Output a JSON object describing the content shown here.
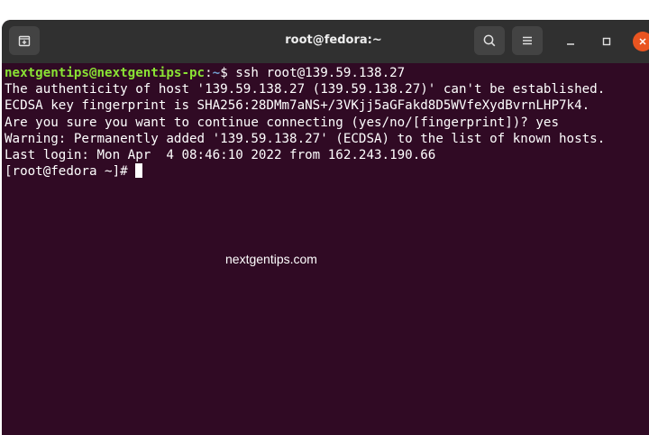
{
  "window": {
    "title": "root@fedora:~"
  },
  "colors": {
    "terminal_bg": "#300a24",
    "prompt_user": "#8ae234",
    "prompt_path": "#729fcf",
    "close_button": "#e95420"
  },
  "icons": {
    "new_tab": "new-tab-icon",
    "search": "search-icon",
    "menu": "hamburger-menu-icon",
    "minimize": "minimize-icon",
    "maximize": "maximize-icon",
    "close": "close-icon"
  },
  "terminal": {
    "prompt": {
      "user_host": "nextgentips@nextgentips-pc",
      "separator": ":",
      "path": "~",
      "symbol": "$ ",
      "command": "ssh root@139.59.138.27"
    },
    "lines": [
      "The authenticity of host '139.59.138.27 (139.59.138.27)' can't be established.",
      "ECDSA key fingerprint is SHA256:28DMm7aNS+/3VKjj5aGFakd8D5WVfeXydBvrnLHP7k4.",
      "Are you sure you want to continue connecting (yes/no/[fingerprint])? yes",
      "Warning: Permanently added '139.59.138.27' (ECDSA) to the list of known hosts.",
      "Last login: Mon Apr  4 08:46:10 2022 from 162.243.190.66"
    ],
    "remote_prompt": "[root@fedora ~]# "
  },
  "watermark": "nextgentips.com"
}
